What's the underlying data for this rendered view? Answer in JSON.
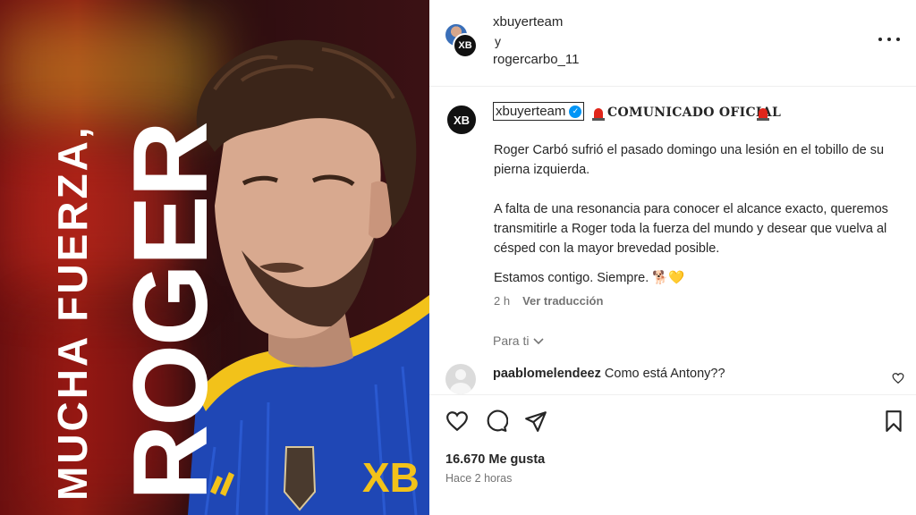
{
  "image": {
    "tagline": "MUCHA FUERZA,",
    "name": "ROGER"
  },
  "header": {
    "user1": "xbuyerteam",
    "connector": "y",
    "user2": "rogercarbo_11",
    "avatar_monogram": "XB"
  },
  "caption": {
    "username": "xbuyerteam",
    "title": "COMUNICADO OFICIAL",
    "paragraph1": "Roger Carbó sufrió el pasado domingo una lesión en el tobillo de su pierna izquierda.",
    "paragraph2": "A falta de una resonancia para conocer el alcance exacto, queremos transmitirle a Roger toda la fuerza del mundo y desear que vuelva al césped con la mayor brevedad posible.",
    "paragraph3": "Estamos contigo. Siempre. 🐕💛",
    "time": "2 h",
    "translate_link": "Ver traducción"
  },
  "for_you": {
    "label": "Para ti"
  },
  "comment": {
    "username": "paablomelendeez",
    "text": "Como está Antony??"
  },
  "stats": {
    "likes": "16.670 Me gusta",
    "posted": "Hace 2 horas"
  },
  "colors": {
    "verified": "#0095f6",
    "siren": "#e0261b",
    "kit_blue": "#1f47b5",
    "kit_yellow": "#f2c21a"
  },
  "icons": [
    "more-icon",
    "verified-icon",
    "siren-icon",
    "chevron-down-icon",
    "heart-icon",
    "comment-icon",
    "share-icon",
    "bookmark-icon"
  ]
}
